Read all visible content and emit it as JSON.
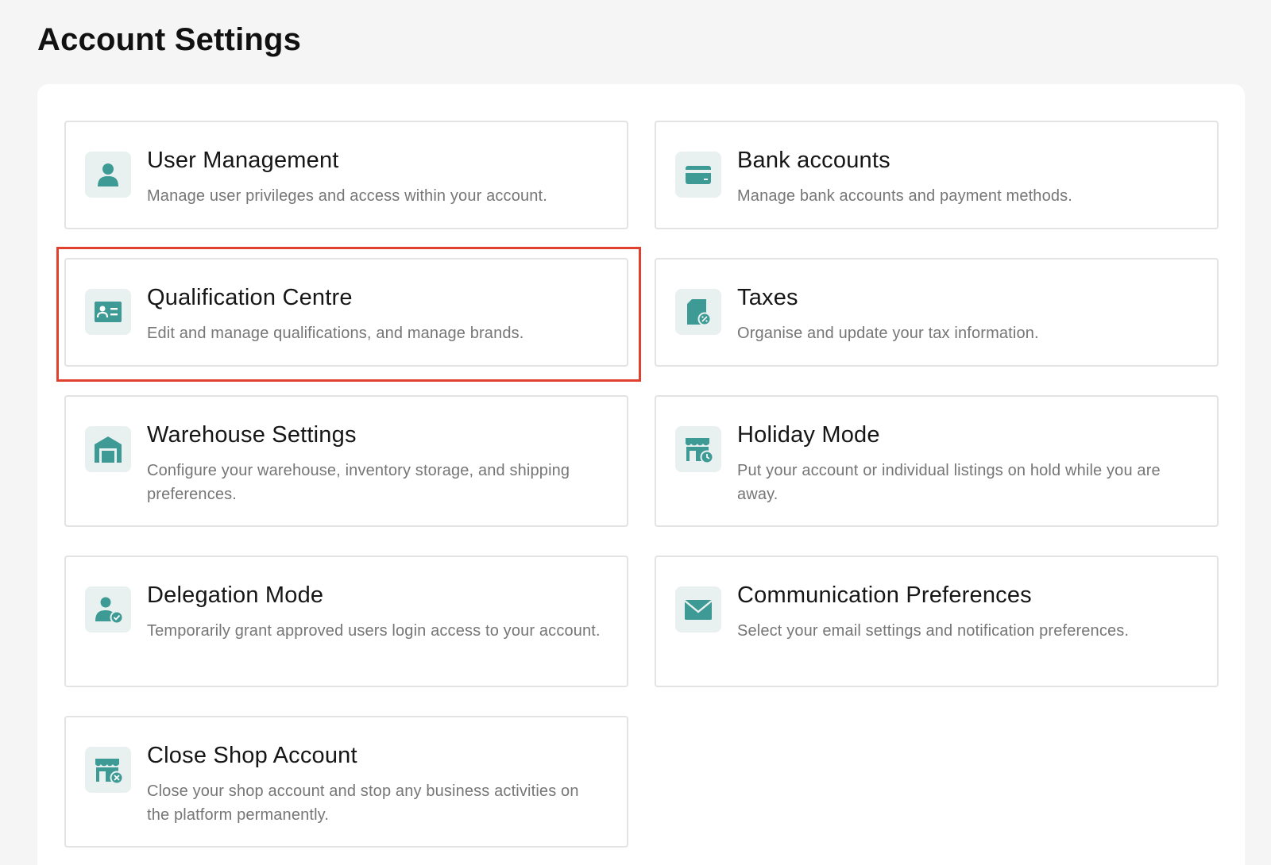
{
  "page": {
    "title": "Account Settings"
  },
  "colors": {
    "icon_teal": "#3d9a94",
    "icon_bg": "#e9f1f0",
    "highlight": "#e0412e"
  },
  "cards": [
    {
      "id": "user-management",
      "icon": "user-icon",
      "title": "User Management",
      "description": "Manage user privileges and access within your account."
    },
    {
      "id": "bank-accounts",
      "icon": "credit-card-icon",
      "title": "Bank accounts",
      "description": "Manage bank accounts and payment methods."
    },
    {
      "id": "qualification-centre",
      "icon": "id-card-icon",
      "title": "Qualification Centre",
      "description": "Edit and manage qualifications, and manage brands."
    },
    {
      "id": "taxes",
      "icon": "tax-document-icon",
      "title": "Taxes",
      "description": "Organise and update your tax information."
    },
    {
      "id": "warehouse-settings",
      "icon": "warehouse-icon",
      "title": "Warehouse Settings",
      "description": "Configure your warehouse, inventory storage, and shipping preferences."
    },
    {
      "id": "holiday-mode",
      "icon": "store-clock-icon",
      "title": "Holiday Mode",
      "description": "Put your account or individual listings on hold while you are away."
    },
    {
      "id": "delegation-mode",
      "icon": "user-check-icon",
      "title": "Delegation Mode",
      "description": "Temporarily grant approved users login access to your account."
    },
    {
      "id": "communication-preferences",
      "icon": "envelope-icon",
      "title": "Communication Preferences",
      "description": "Select your email settings and notification preferences."
    },
    {
      "id": "close-shop-account",
      "icon": "store-close-icon",
      "title": "Close Shop Account",
      "description": "Close your shop account and stop any business activities on the platform permanently."
    }
  ]
}
